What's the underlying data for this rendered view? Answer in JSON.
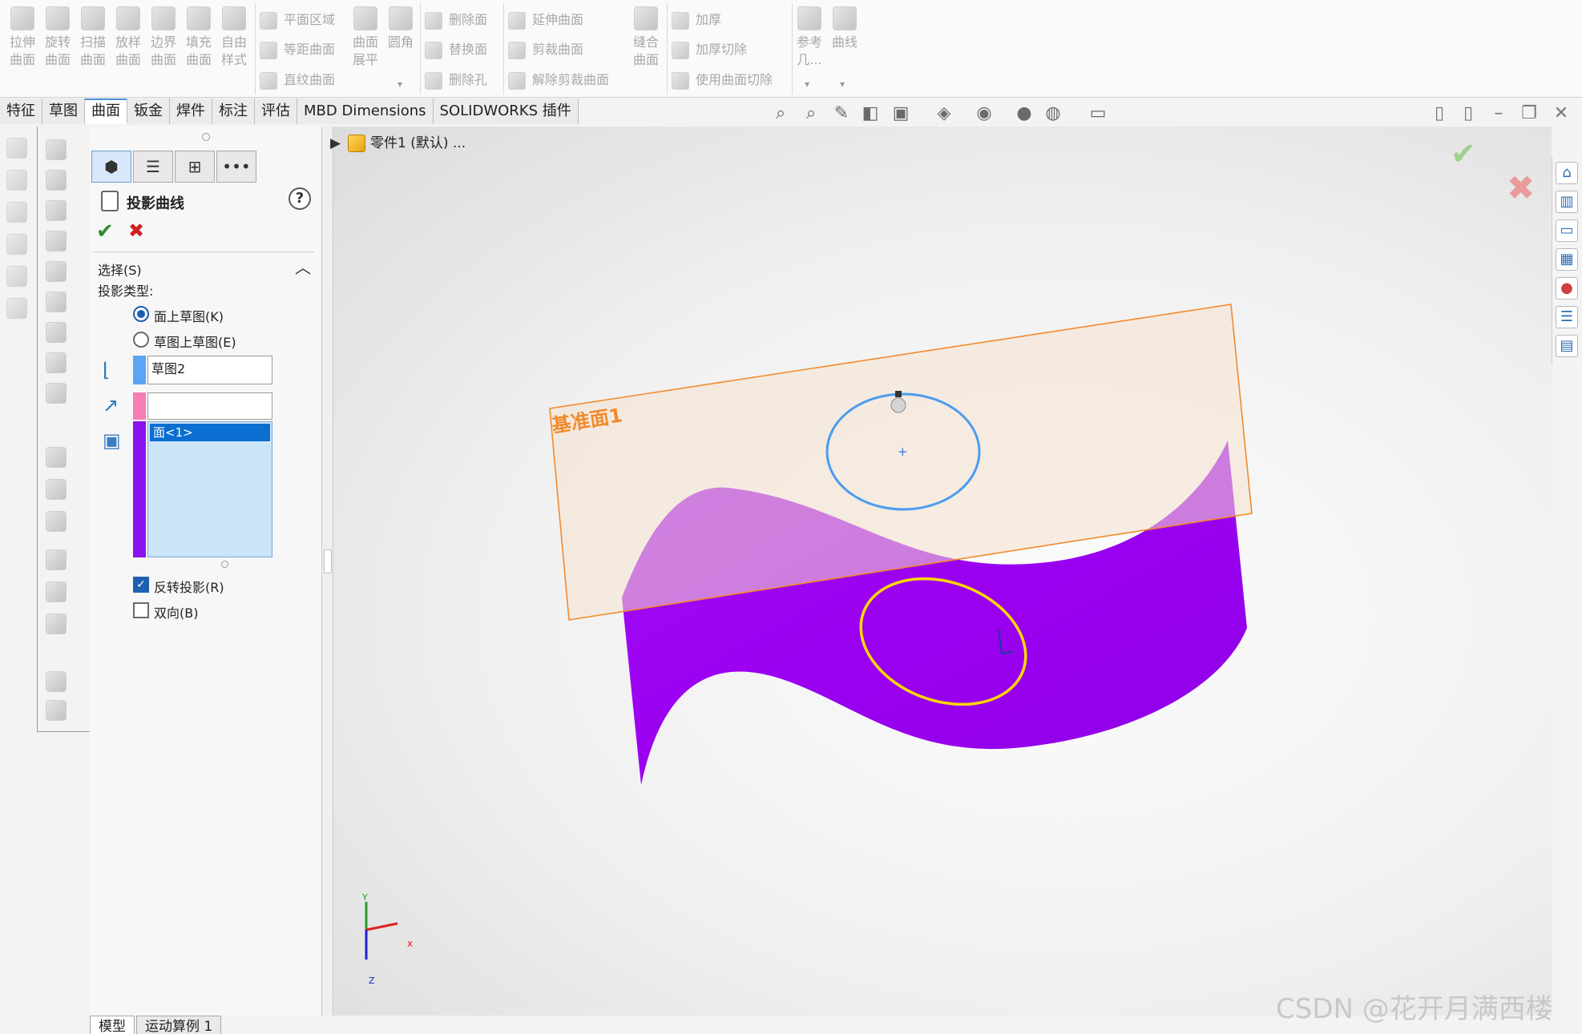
{
  "ribbon": {
    "big_buttons": [
      {
        "label": "拉伸\n曲面"
      },
      {
        "label": "旋转\n曲面"
      },
      {
        "label": "扫描\n曲面"
      },
      {
        "label": "放样\n曲面"
      },
      {
        "label": "边界\n曲面"
      },
      {
        "label": "填充\n曲面"
      },
      {
        "label": "自由\n样式"
      }
    ],
    "group2": [
      "平面区域",
      "等距曲面",
      "直纹曲面"
    ],
    "group2_big": [
      {
        "label": "曲面\n展平"
      },
      {
        "label": "圆角"
      }
    ],
    "group3": [
      "删除面",
      "替换面",
      "删除孔"
    ],
    "group4": [
      "延伸曲面",
      "剪裁曲面",
      "解除剪裁曲面"
    ],
    "group5_big": {
      "label": "缝合\n曲面"
    },
    "group6": [
      "加厚",
      "加厚切除",
      "使用曲面切除"
    ],
    "group7_big": [
      {
        "label": "参考\n几..."
      },
      {
        "label": "曲线"
      }
    ]
  },
  "tabs": [
    "特征",
    "草图",
    "曲面",
    "钣金",
    "焊件",
    "标注",
    "评估",
    "MBD Dimensions",
    "SOLIDWORKS 插件"
  ],
  "active_tab": "曲面",
  "tree": {
    "root": "零件1 (默认) ..."
  },
  "panel": {
    "title": "投影曲线",
    "help": "?",
    "ok_icon": "✔",
    "cancel_icon": "✖",
    "section_title": "选择(S)",
    "projection_type_label": "投影类型:",
    "options": [
      "面上草图(K)",
      "草图上草图(E)"
    ],
    "selected_option": "面上草图(K)",
    "sketch_field": "草图2",
    "direction_field": "",
    "faces_item": "面<1>",
    "reverse_label": "反转投影(R)",
    "reverse_checked": true,
    "bidirectional_label": "双向(B)",
    "bidirectional_checked": false
  },
  "viewport": {
    "plane_label": "基准面1",
    "axis_x": "x",
    "axis_y": "Y",
    "axis_z": "Z",
    "colors": {
      "surface": "#9b00f2",
      "plane_border": "#f28a2c",
      "sketch_circle": "#4a9df0",
      "projected_curve": "#ffd800"
    }
  },
  "bottom_tabs": [
    "模型",
    "运动算例 1"
  ],
  "watermark": "CSDN @花开月满西楼"
}
